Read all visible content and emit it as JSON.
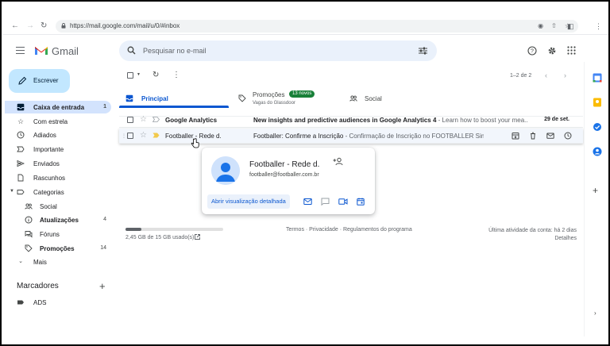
{
  "browser": {
    "url": "https://mail.google.com/mail/u/0/#inbox"
  },
  "header": {
    "app_name": "Gmail",
    "search_placeholder": "Pesquisar no e-mail"
  },
  "compose": {
    "label": "Escrever"
  },
  "sidebar": {
    "items": [
      {
        "label": "Caixa de entrada",
        "count": "1",
        "icon": "inbox-icon",
        "active": true
      },
      {
        "label": "Com estrela",
        "count": "",
        "icon": "star-icon"
      },
      {
        "label": "Adiados",
        "count": "",
        "icon": "clock-icon"
      },
      {
        "label": "Importante",
        "count": "",
        "icon": "important-icon"
      },
      {
        "label": "Enviados",
        "count": "",
        "icon": "send-icon"
      },
      {
        "label": "Rascunhos",
        "count": "",
        "icon": "draft-icon"
      },
      {
        "label": "Categorias",
        "count": "",
        "icon": "label-icon"
      },
      {
        "label": "Social",
        "count": "",
        "icon": "people-icon"
      },
      {
        "label": "Atualizações",
        "count": "4",
        "icon": "info-icon"
      },
      {
        "label": "Fóruns",
        "count": "",
        "icon": "forum-icon"
      },
      {
        "label": "Promoções",
        "count": "14",
        "icon": "tag-icon"
      },
      {
        "label": "Mais",
        "count": "",
        "icon": "chevron-down-icon"
      }
    ],
    "markers_title": "Marcadores",
    "labels": [
      {
        "label": "ADS"
      }
    ]
  },
  "toolbar": {
    "pager": "1–2 de 2"
  },
  "tabs": [
    {
      "label": "Principal",
      "sub": "",
      "active": true
    },
    {
      "label": "Promoções",
      "sub": "Vagas do Glassdoor",
      "badge": "13 novos"
    },
    {
      "label": "Social",
      "sub": ""
    }
  ],
  "emails": [
    {
      "sender": "Google Analytics",
      "subject": "New insights and predictive audiences in Google Analytics 4",
      "snippet": " - Learn how to boost your mea...",
      "date": "29 de set.",
      "unread": true
    },
    {
      "sender": "Footballer - Rede d.",
      "subject": "Footballer: Confirme a Inscrição",
      "snippet": " - Confirmação de Inscrição no FOOTBALLER Sim, ins...",
      "date": "",
      "unread": false
    }
  ],
  "storage": {
    "text": "2,45 GB de 15 GB usado(s)",
    "used_fraction": 0.163
  },
  "footer": {
    "links": "Termos · Privacidade · Regulamentos do programa",
    "activity": "Última atividade da conta: há 2 dias",
    "details": "Detalhes"
  },
  "hover_card": {
    "name": "Footballer - Rede d.",
    "email": "footballer@footballer.com.br",
    "detail_button": "Abrir visualização detalhada"
  },
  "colors": {
    "accent": "#0b57d0",
    "compose_bg": "#c2e7ff",
    "active_nav": "#d3e3fd",
    "badge": "#188038"
  }
}
